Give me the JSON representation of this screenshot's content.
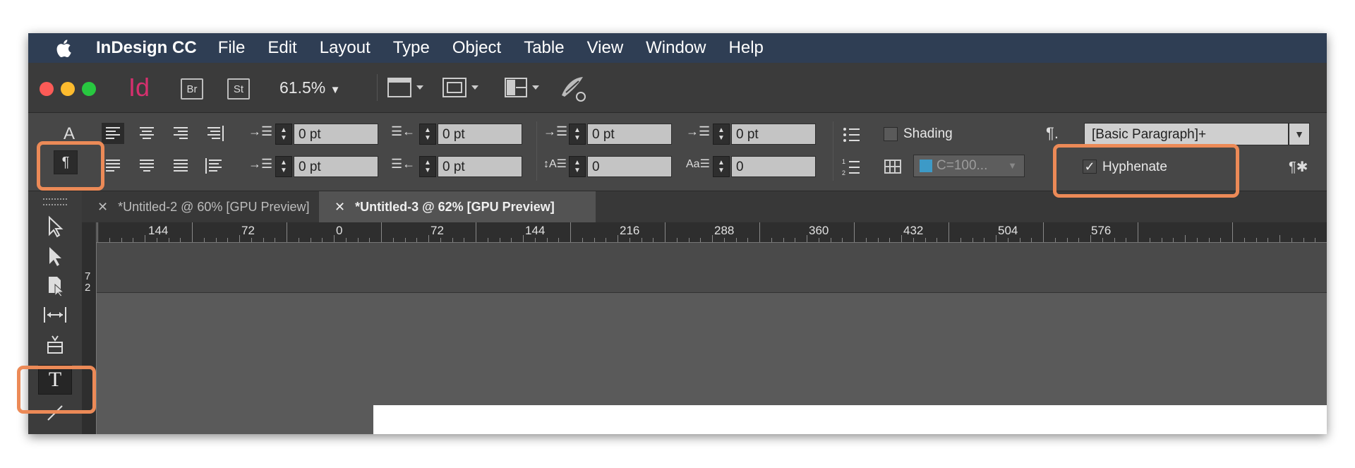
{
  "menubar": {
    "app_name": "InDesign CC",
    "items": [
      "File",
      "Edit",
      "Layout",
      "Type",
      "Object",
      "Table",
      "View",
      "Window",
      "Help"
    ]
  },
  "toolbar": {
    "logo": "Id",
    "bridge": "Br",
    "stock": "St",
    "zoom": "61.5%"
  },
  "control_panel": {
    "char_mode_label": "A",
    "left_indent": "0 pt",
    "right_indent": "0 pt",
    "space_before": "0 pt",
    "space_after": "0 pt",
    "first_line_indent": "0 pt",
    "last_line_indent": "0 pt",
    "drop_cap_lines": "0",
    "drop_cap_chars": "0",
    "shading_label": "Shading",
    "shading_color": "C=100...",
    "paragraph_style": "[Basic Paragraph]+",
    "hyphenate_label": "Hyphenate",
    "hyphenate_checked": true
  },
  "tabs": [
    {
      "label": "*Untitled-2 @ 60% [GPU Preview]",
      "active": false
    },
    {
      "label": "*Untitled-3 @ 62% [GPU Preview]",
      "active": true
    }
  ],
  "ruler": {
    "labels": [
      "144",
      "72",
      "0",
      "72",
      "144",
      "216",
      "288",
      "360",
      "432",
      "504",
      "576"
    ],
    "vertical_labels": [
      "7",
      "2"
    ]
  },
  "colors": {
    "highlight": "#ec8a57",
    "menubar": "#2f3e54",
    "logo": "#d6306e"
  }
}
